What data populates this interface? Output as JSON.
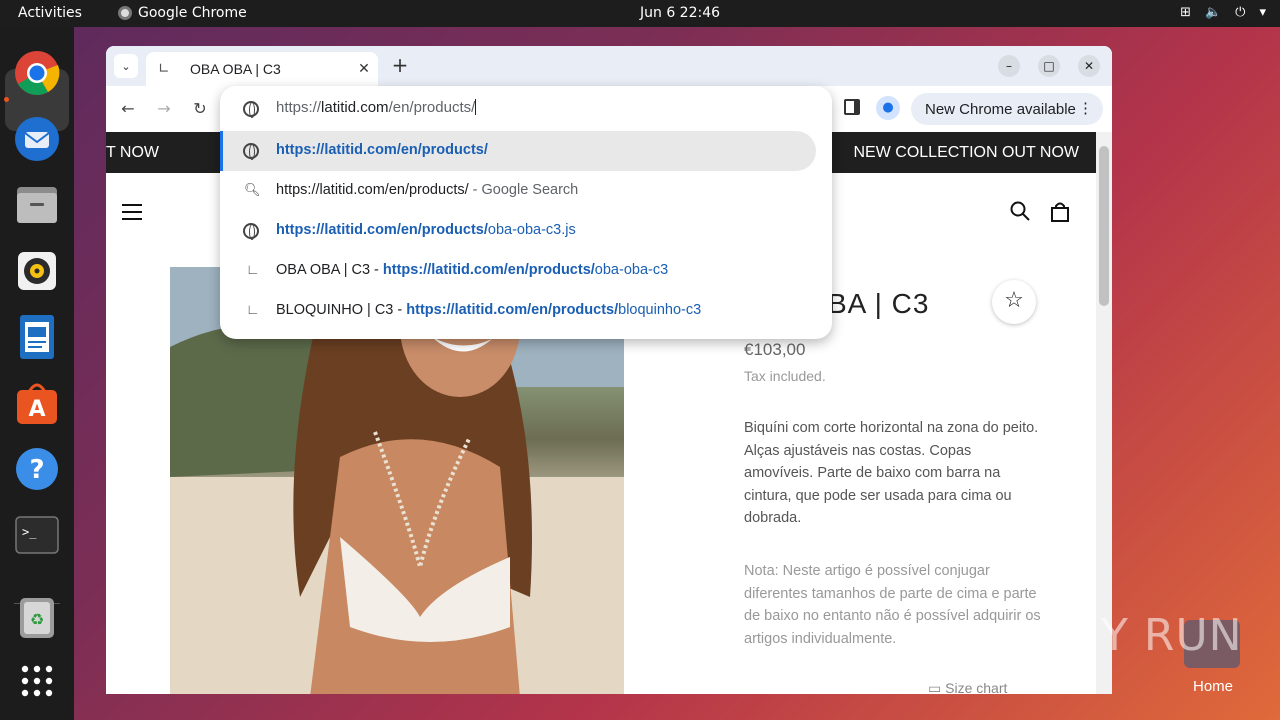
{
  "topbar": {
    "activities": "Activities",
    "app_name": "Google Chrome",
    "clock": "Jun 6  22:46"
  },
  "browser": {
    "tab_title": "OBA OBA | C3",
    "update_label": "New Chrome available",
    "omnibox": {
      "url_scheme": "https://",
      "url_host": "latitid.com",
      "url_path": "/en/products/",
      "suggestions": [
        {
          "main": "https://latitid.com/en/products/",
          "suffix": ""
        },
        {
          "main": "https://latitid.com/en/products/",
          "suffix": " - Google Search"
        },
        {
          "main": "https://latitid.com/en/products/",
          "suffix": "oba-oba-c3.js"
        },
        {
          "prefix": "OBA OBA | C3 - ",
          "main": "https://latitid.com/en/products/",
          "suffix": "oba-oba-c3"
        },
        {
          "prefix": "BLOQUINHO | C3 - ",
          "main": "https://latitid.com/en/products/",
          "suffix": "bloquinho-c3"
        }
      ]
    }
  },
  "page": {
    "announcement_left": "T NOW",
    "announcement_right": "NEW COLLECTION OUT NOW",
    "product_title": "BA | C3",
    "price": "€103,00",
    "tax": "Tax included.",
    "description": "Biquíni com corte horizontal na zona do peito. Alças ajustáveis nas costas. Copas amovíveis. Parte de baixo com barra na cintura, que pode ser usada para cima ou dobrada.",
    "note": "Nota: Neste artigo é possível conjugar diferentes tamanhos de parte de cima e parte de baixo no entanto não é possível adquirir os artigos individualmente.",
    "size_chart": "Size chart"
  },
  "desktop": {
    "watermark": "ANY RUN",
    "home_label": "Home"
  },
  "colors": {
    "accent_orange": "#e95420",
    "link_blue": "#1a5fb4",
    "selection_bar": "#1a73e8"
  }
}
